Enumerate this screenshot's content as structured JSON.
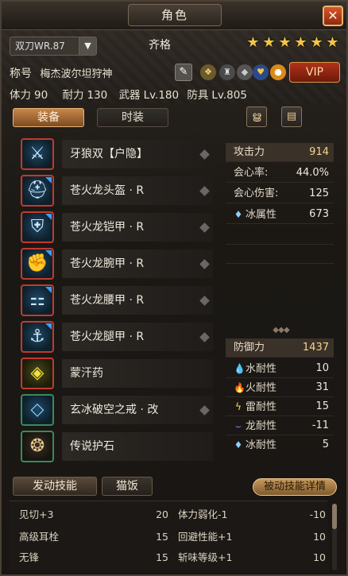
{
  "window": {
    "title": "角色",
    "close_icon": "close-x-icon"
  },
  "header": {
    "weapon_select": "双刀WR.87",
    "hunter_name": "齐格",
    "star_count": 6,
    "title_label": "称号",
    "title_value": "梅杰波尔坦狩神",
    "vip_label": "VIP",
    "stats": {
      "stamina_label": "体力",
      "stamina_value": "90",
      "endurance_label": "耐力",
      "endurance_value": "130",
      "weapon_label": "武器",
      "weapon_value": "Lv.180",
      "armor_label": "防具",
      "armor_value": "Lv.805"
    }
  },
  "tabs": {
    "equipment": "装备",
    "fashion": "时装"
  },
  "equipment": [
    {
      "name": "牙狼双【户隐】",
      "icon": "dual-blades-icon",
      "frame": "red"
    },
    {
      "name": "苍火龙头盔 · R",
      "icon": "helmet-icon",
      "frame": "red"
    },
    {
      "name": "苍火龙铠甲 · R",
      "icon": "chest-armor-icon",
      "frame": "red"
    },
    {
      "name": "苍火龙腕甲 · R",
      "icon": "gauntlet-icon",
      "frame": "red"
    },
    {
      "name": "苍火龙腰甲 · R",
      "icon": "waist-armor-icon",
      "frame": "red"
    },
    {
      "name": "苍火龙腿甲 · R",
      "icon": "leg-armor-icon",
      "frame": "red"
    },
    {
      "name": "蒙汗药",
      "icon": "potion-icon",
      "frame": "red"
    },
    {
      "name": "玄冰破空之戒 · 改",
      "icon": "ring-icon",
      "frame": "green"
    },
    {
      "name": "传说护石",
      "icon": "talisman-icon",
      "frame": "green"
    }
  ],
  "attack_stats": [
    {
      "label": "攻击力",
      "value": "914",
      "highlight": true
    },
    {
      "label": "会心率:",
      "value": "44.0%"
    },
    {
      "label": "会心伤害:",
      "value": "125"
    },
    {
      "label": "冰属性",
      "value": "673",
      "icon": "ice-icon"
    }
  ],
  "defense_stats": [
    {
      "label": "防御力",
      "value": "1437",
      "highlight": true
    },
    {
      "label": "水耐性",
      "value": "10",
      "icon": "water-icon"
    },
    {
      "label": "火耐性",
      "value": "31",
      "icon": "fire-icon"
    },
    {
      "label": "雷耐性",
      "value": "15",
      "icon": "thunder-icon"
    },
    {
      "label": "龙耐性",
      "value": "-11",
      "icon": "dragon-icon"
    },
    {
      "label": "冰耐性",
      "value": "5",
      "icon": "ice-icon"
    }
  ],
  "bottom_tabs": {
    "active_skills": "发动技能",
    "cat_food": "猫饭",
    "passive_detail": "被动技能详情"
  },
  "skills": [
    {
      "name": "见切+3",
      "value": "20"
    },
    {
      "name": "体力弱化-1",
      "value": "-10"
    },
    {
      "name": "高级耳栓",
      "value": "15"
    },
    {
      "name": "回避性能+1",
      "value": "10"
    },
    {
      "name": "无锋",
      "value": "15"
    },
    {
      "name": "斩味等级+1",
      "value": "10"
    }
  ],
  "colors": {
    "accent_gold": "#f3c547",
    "highlight_value": "#f3d58a",
    "vip_red": "#b0321a",
    "frame_red": "#c23a2c",
    "frame_green": "#3a8a5a"
  }
}
